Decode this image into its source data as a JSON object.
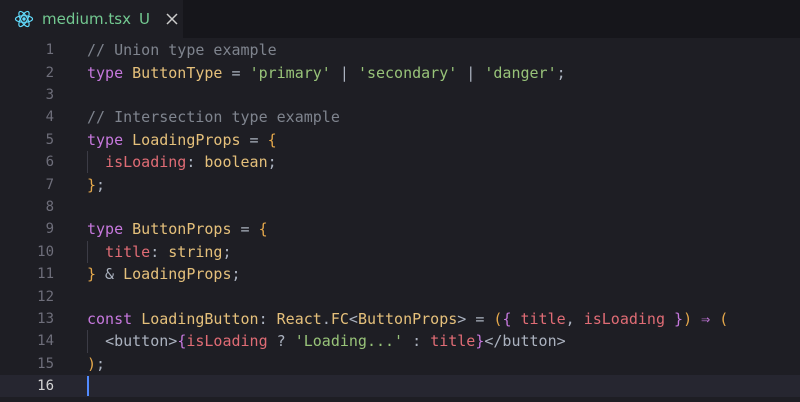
{
  "tab": {
    "filename": "medium.tsx",
    "status": "U",
    "icon": "react-icon",
    "close_icon": "close-icon"
  },
  "editor": {
    "current_line": 16,
    "line_numbers": [
      "1",
      "2",
      "3",
      "4",
      "5",
      "6",
      "7",
      "8",
      "9",
      "10",
      "11",
      "12",
      "13",
      "14",
      "15",
      "16"
    ],
    "lines": [
      [
        {
          "t": "// Union type example",
          "c": "comment"
        }
      ],
      [
        {
          "t": "type",
          "c": "kw"
        },
        {
          "t": " ",
          "c": "punc"
        },
        {
          "t": "ButtonType",
          "c": "type"
        },
        {
          "t": " = ",
          "c": "punc"
        },
        {
          "t": "'primary'",
          "c": "str"
        },
        {
          "t": " | ",
          "c": "punc"
        },
        {
          "t": "'secondary'",
          "c": "str"
        },
        {
          "t": " | ",
          "c": "punc"
        },
        {
          "t": "'danger'",
          "c": "str"
        },
        {
          "t": ";",
          "c": "punc"
        }
      ],
      [],
      [
        {
          "t": "// Intersection type example",
          "c": "comment"
        }
      ],
      [
        {
          "t": "type",
          "c": "kw"
        },
        {
          "t": " ",
          "c": "punc"
        },
        {
          "t": "LoadingProps",
          "c": "type"
        },
        {
          "t": " = ",
          "c": "punc"
        },
        {
          "t": "{",
          "c": "brace"
        }
      ],
      [
        {
          "t": "  ",
          "c": "punc"
        },
        {
          "t": "isLoading",
          "c": "prop"
        },
        {
          "t": ": ",
          "c": "punc"
        },
        {
          "t": "boolean",
          "c": "type"
        },
        {
          "t": ";",
          "c": "punc"
        }
      ],
      [
        {
          "t": "}",
          "c": "brace"
        },
        {
          "t": ";",
          "c": "punc"
        }
      ],
      [],
      [
        {
          "t": "type",
          "c": "kw"
        },
        {
          "t": " ",
          "c": "punc"
        },
        {
          "t": "ButtonProps",
          "c": "type"
        },
        {
          "t": " = ",
          "c": "punc"
        },
        {
          "t": "{",
          "c": "brace"
        }
      ],
      [
        {
          "t": "  ",
          "c": "punc"
        },
        {
          "t": "title",
          "c": "prop"
        },
        {
          "t": ": ",
          "c": "punc"
        },
        {
          "t": "string",
          "c": "type"
        },
        {
          "t": ";",
          "c": "punc"
        }
      ],
      [
        {
          "t": "}",
          "c": "brace"
        },
        {
          "t": " & ",
          "c": "punc"
        },
        {
          "t": "LoadingProps",
          "c": "type"
        },
        {
          "t": ";",
          "c": "punc"
        }
      ],
      [],
      [
        {
          "t": "const",
          "c": "kw"
        },
        {
          "t": " ",
          "c": "punc"
        },
        {
          "t": "LoadingButton",
          "c": "ident"
        },
        {
          "t": ": ",
          "c": "punc"
        },
        {
          "t": "React",
          "c": "ident"
        },
        {
          "t": ".",
          "c": "punc"
        },
        {
          "t": "FC",
          "c": "type"
        },
        {
          "t": "<",
          "c": "punc"
        },
        {
          "t": "ButtonProps",
          "c": "type"
        },
        {
          "t": ">",
          "c": "punc"
        },
        {
          "t": " = ",
          "c": "punc"
        },
        {
          "t": "(",
          "c": "brace"
        },
        {
          "t": "{",
          "c": "kw"
        },
        {
          "t": " ",
          "c": "punc"
        },
        {
          "t": "title",
          "c": "prop"
        },
        {
          "t": ", ",
          "c": "punc"
        },
        {
          "t": "isLoading",
          "c": "prop"
        },
        {
          "t": " ",
          "c": "punc"
        },
        {
          "t": "}",
          "c": "kw"
        },
        {
          "t": ")",
          "c": "brace"
        },
        {
          "t": " ⇒ ",
          "c": "op"
        },
        {
          "t": "(",
          "c": "brace"
        }
      ],
      [
        {
          "t": "  ",
          "c": "punc"
        },
        {
          "t": "<button>",
          "c": "tag"
        },
        {
          "t": "{",
          "c": "kw"
        },
        {
          "t": "isLoading",
          "c": "prop"
        },
        {
          "t": " ? ",
          "c": "punc"
        },
        {
          "t": "'Loading...'",
          "c": "str"
        },
        {
          "t": " : ",
          "c": "punc"
        },
        {
          "t": "title",
          "c": "prop"
        },
        {
          "t": "}",
          "c": "kw"
        },
        {
          "t": "</button>",
          "c": "tag"
        }
      ],
      [
        {
          "t": ")",
          "c": "brace"
        },
        {
          "t": ";",
          "c": "punc"
        }
      ],
      []
    ]
  },
  "colors": {
    "background": "#1e1e24",
    "tab_text": "#73c991",
    "react_icon": "#61dafb",
    "cursor": "#528bff"
  }
}
